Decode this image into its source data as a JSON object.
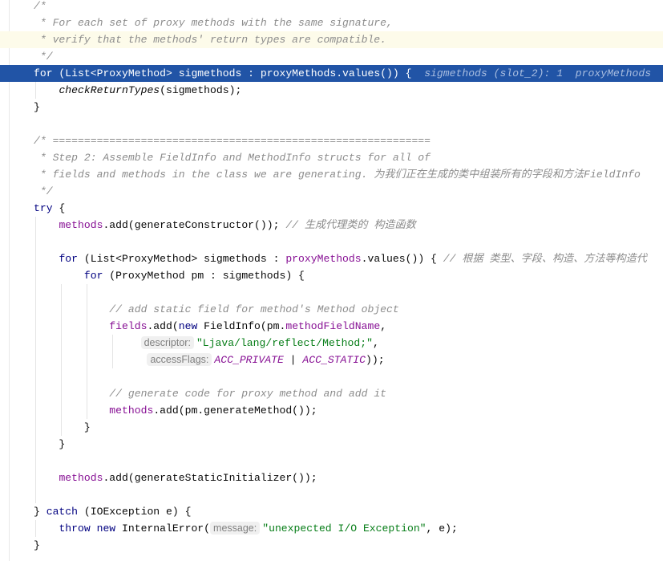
{
  "editor": {
    "current_line": 4,
    "caret_line": 2,
    "colors": {
      "current_line_bg": "#2154a6",
      "caret_line_bg": "#fdfbea",
      "keyword": "#000080",
      "field": "#871094",
      "comment": "#8c8c8c",
      "string": "#067d17"
    },
    "lines": [
      [
        {
          "t": "/*",
          "c": "cmt"
        }
      ],
      [
        {
          "t": " * For each set of proxy methods with the same signature,",
          "c": "cmt"
        }
      ],
      [
        {
          "t": " * verify that the methods' return types are compatible.",
          "c": "cmt"
        }
      ],
      [
        {
          "t": " */",
          "c": "cmt"
        }
      ],
      [
        {
          "t": "for",
          "c": "kwb"
        },
        {
          "t": " (List<ProxyMethod> sigmethods : "
        },
        {
          "t": "proxyMethods",
          "c": "fld"
        },
        {
          "t": ".values()) {"
        },
        {
          "t": "  sigmethods (slot_2): 1  proxyMethods",
          "c": "hint-inline"
        }
      ],
      [
        {
          "t": "    "
        },
        {
          "t": "checkReturnTypes",
          "c": "mi"
        },
        {
          "t": "(sigmethods);"
        }
      ],
      [
        {
          "t": "}"
        }
      ],
      [],
      [
        {
          "t": "/* ============================================================",
          "c": "cmt"
        }
      ],
      [
        {
          "t": " * Step 2: Assemble FieldInfo and MethodInfo structs for all of",
          "c": "cmt"
        }
      ],
      [
        {
          "t": " * fields and methods in the class we are generating. 为我们正在生成的类中组装所有的字段和方法FieldInfo",
          "c": "cmt"
        }
      ],
      [
        {
          "t": " */",
          "c": "cmt"
        }
      ],
      [
        {
          "t": "try",
          "c": "kwb"
        },
        {
          "t": " {"
        }
      ],
      [
        {
          "t": "    "
        },
        {
          "t": "methods",
          "c": "fld"
        },
        {
          "t": ".add(generateConstructor()); "
        },
        {
          "t": "// 生成代理类的 构造函数",
          "c": "cmt"
        }
      ],
      [],
      [
        {
          "t": "    "
        },
        {
          "t": "for",
          "c": "kwb"
        },
        {
          "t": " (List<ProxyMethod> sigmethods : "
        },
        {
          "t": "proxyMethods",
          "c": "fld"
        },
        {
          "t": ".values()) { "
        },
        {
          "t": "// 根据 类型、字段、构造、方法等构造代",
          "c": "cmt"
        }
      ],
      [
        {
          "t": "        "
        },
        {
          "t": "for",
          "c": "kwb"
        },
        {
          "t": " (ProxyMethod pm : sigmethods) {"
        }
      ],
      [],
      [
        {
          "t": "            "
        },
        {
          "t": "// add static field for method's Method object",
          "c": "cmt"
        }
      ],
      [
        {
          "t": "            "
        },
        {
          "t": "fields",
          "c": "fld"
        },
        {
          "t": ".add("
        },
        {
          "t": "new",
          "c": "kwb"
        },
        {
          "t": " FieldInfo(pm."
        },
        {
          "t": "methodFieldName",
          "c": "fld"
        },
        {
          "t": ","
        }
      ],
      [
        {
          "t": "                 "
        },
        {
          "t": "descriptor:",
          "c": "hint"
        },
        {
          "t": "\"Ljava/lang/reflect/Method;\"",
          "c": "str"
        },
        {
          "t": ","
        }
      ],
      [
        {
          "t": "                  "
        },
        {
          "t": "accessFlags:",
          "c": "hint"
        },
        {
          "t": "ACC_PRIVATE",
          "c": "cst"
        },
        {
          "t": " | "
        },
        {
          "t": "ACC_STATIC",
          "c": "cst"
        },
        {
          "t": "));"
        }
      ],
      [],
      [
        {
          "t": "            "
        },
        {
          "t": "// generate code for proxy method and add it",
          "c": "cmt"
        }
      ],
      [
        {
          "t": "            "
        },
        {
          "t": "methods",
          "c": "fld"
        },
        {
          "t": ".add(pm.generateMethod());"
        }
      ],
      [
        {
          "t": "        }"
        }
      ],
      [
        {
          "t": "    }"
        }
      ],
      [],
      [
        {
          "t": "    "
        },
        {
          "t": "methods",
          "c": "fld"
        },
        {
          "t": ".add(generateStaticInitializer());"
        }
      ],
      [],
      [
        {
          "t": "} "
        },
        {
          "t": "catch",
          "c": "kwb"
        },
        {
          "t": " (IOException e) {"
        }
      ],
      [
        {
          "t": "    "
        },
        {
          "t": "throw new",
          "c": "kwb"
        },
        {
          "t": " InternalError("
        },
        {
          "t": "message:",
          "c": "hint"
        },
        {
          "t": "\"unexpected I/O Exception\"",
          "c": "str"
        },
        {
          "t": ", e);"
        }
      ],
      [
        {
          "t": "}"
        }
      ]
    ]
  }
}
